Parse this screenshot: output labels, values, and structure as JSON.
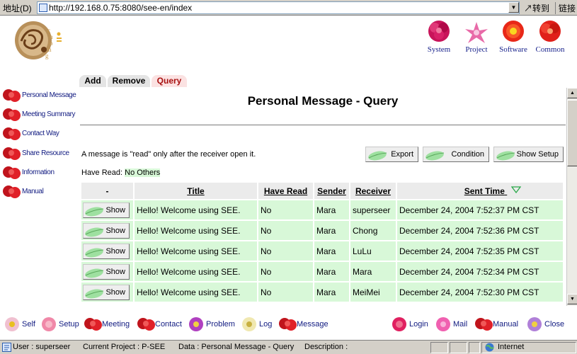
{
  "address_bar": {
    "label": "地址(D)",
    "url": "http://192.168.0.75:8080/see-en/index",
    "go_label": "转到",
    "links_label": "链接"
  },
  "logo": {
    "text": "chong",
    "mark": "忠忠"
  },
  "top_nav": [
    {
      "label": "System",
      "color": "#c8145a"
    },
    {
      "label": "Project",
      "color": "#e86aa8"
    },
    {
      "label": "Software",
      "color": "#e82818"
    },
    {
      "label": "Common",
      "color": "#e0201a"
    }
  ],
  "left_menu": [
    {
      "label": "Personal Message"
    },
    {
      "label": "Meeting Summary"
    },
    {
      "label": "Contact Way"
    },
    {
      "label": "Share Resource"
    },
    {
      "label": "Information"
    },
    {
      "label": "Manual"
    }
  ],
  "tabs": {
    "add": "Add",
    "remove": "Remove",
    "query": "Query"
  },
  "page_title": "Personal Message - Query",
  "notice": "A message is \"read\" only after the receiver open it.",
  "toolbar": {
    "export": "Export",
    "condition": "Condition",
    "show_setup": "Show Setup"
  },
  "have_read": {
    "label": "Have Read:",
    "value": "No Others"
  },
  "table": {
    "columns": [
      "-",
      "Title",
      "Have Read",
      "Sender",
      "Receiver",
      "Sent Time"
    ],
    "show_label": "Show",
    "rows": [
      {
        "title": "Hello! Welcome using SEE.",
        "read": "No",
        "sender": "Mara",
        "receiver": "superseer",
        "time": "December 24, 2004 7:52:37 PM CST"
      },
      {
        "title": "Hello! Welcome using SEE.",
        "read": "No",
        "sender": "Mara",
        "receiver": "Chong",
        "time": "December 24, 2004 7:52:36 PM CST"
      },
      {
        "title": "Hello! Welcome using SEE.",
        "read": "No",
        "sender": "Mara",
        "receiver": "LuLu",
        "time": "December 24, 2004 7:52:35 PM CST"
      },
      {
        "title": "Hello! Welcome using SEE.",
        "read": "No",
        "sender": "Mara",
        "receiver": "Mara",
        "time": "December 24, 2004 7:52:34 PM CST"
      },
      {
        "title": "Hello! Welcome using SEE.",
        "read": "No",
        "sender": "Mara",
        "receiver": "MeiMei",
        "time": "December 24, 2004 7:52:30 PM CST"
      }
    ]
  },
  "bottom_nav": [
    {
      "label": "Self"
    },
    {
      "label": "Setup"
    },
    {
      "label": "Meeting"
    },
    {
      "label": "Contact"
    },
    {
      "label": "Problem"
    },
    {
      "label": "Log"
    },
    {
      "label": "Message"
    },
    {
      "label": "Login"
    },
    {
      "label": "Mail"
    },
    {
      "label": "Manual"
    },
    {
      "label": "Close"
    }
  ],
  "status_bar": {
    "user": "User : superseer",
    "project": "Current Project : P-SEE",
    "data": "Data : Personal Message - Query",
    "description": "Description :",
    "zone": "Internet"
  },
  "colors": {
    "row_bg": "#d8f8d8",
    "header_bg": "#ebebeb",
    "link_blue": "#101a80",
    "query_tab": "#fbe2e2"
  }
}
